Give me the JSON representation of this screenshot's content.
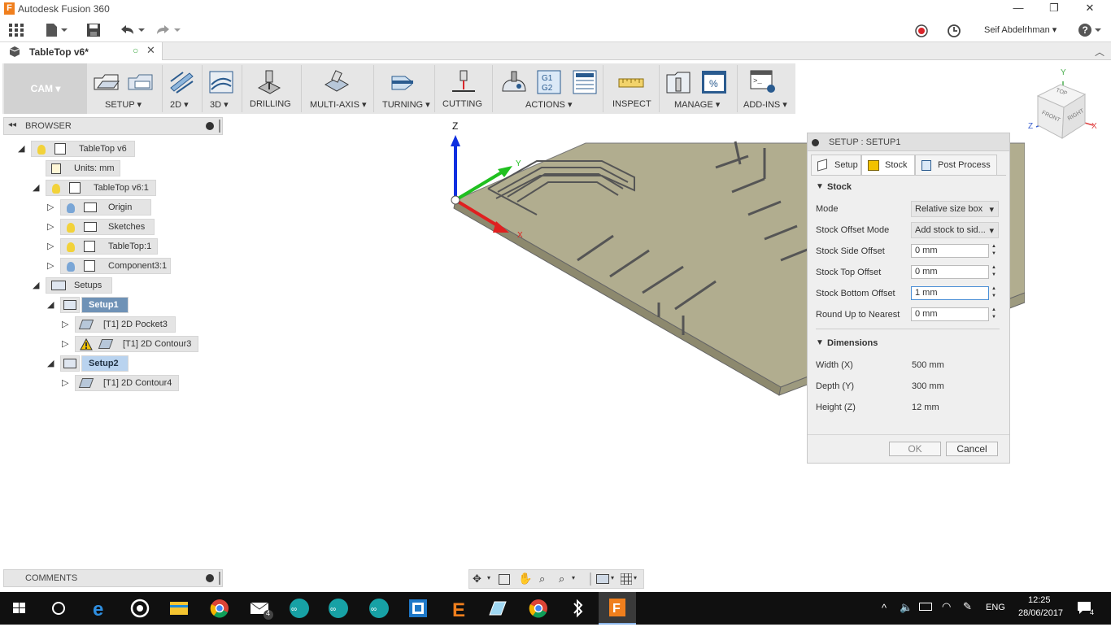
{
  "window": {
    "app_title": "Autodesk Fusion 360",
    "logo_letter": "F",
    "minimize": "—",
    "restore": "❐",
    "close": "✕"
  },
  "qat": {
    "user_name": "Seif Abdelrhman"
  },
  "document_tab": {
    "name": "TableTop v6*"
  },
  "ribbon": {
    "workspace": "CAM",
    "groups": [
      "SETUP",
      "2D",
      "3D",
      "DRILLING",
      "MULTI-AXIS",
      "TURNING",
      "CUTTING",
      "ACTIONS",
      "INSPECT",
      "MANAGE",
      "ADD-INS"
    ]
  },
  "browser": {
    "title": "BROWSER",
    "nodes": {
      "root": "TableTop v6",
      "units": "Units: mm",
      "component": "TableTop v6:1",
      "origin": "Origin",
      "sketches": "Sketches",
      "body": "TableTop:1",
      "component3": "Component3:1",
      "setups": "Setups",
      "setup1": "Setup1",
      "pocket3": "[T1] 2D Pocket3",
      "contour3": "[T1] 2D Contour3",
      "setup2": "Setup2",
      "contour4": "[T1] 2D Contour4"
    }
  },
  "comments": {
    "title": "COMMENTS"
  },
  "viewport": {
    "axis_z": "Z",
    "axis_y": "Y",
    "axis_x": "X",
    "cube_labels": {
      "top": "TOP",
      "front": "FRONT",
      "right": "RIGHT",
      "x": "X",
      "y": "Y",
      "z": "Z"
    }
  },
  "dialog": {
    "title": "SETUP : SETUP1",
    "tabs": [
      "Setup",
      "Stock",
      "Post Process"
    ],
    "stock_section": "Stock",
    "fields": {
      "mode_label": "Mode",
      "mode_value": "Relative size box",
      "offset_mode_label": "Stock Offset Mode",
      "offset_mode_value": "Add stock to sid...",
      "side_label": "Stock Side Offset",
      "side_value": "0 mm",
      "top_label": "Stock Top Offset",
      "top_value": "0 mm",
      "bottom_label": "Stock Bottom Offset",
      "bottom_value": "1 mm",
      "round_label": "Round Up to Nearest",
      "round_value": "0 mm"
    },
    "dimensions_section": "Dimensions",
    "dimensions": {
      "width_label": "Width (X)",
      "width_value": "500 mm",
      "depth_label": "Depth (Y)",
      "depth_value": "300 mm",
      "height_label": "Height (Z)",
      "height_value": "12 mm"
    },
    "ok": "OK",
    "cancel": "Cancel"
  },
  "taskbar": {
    "clock_time": "12:25",
    "clock_date": "28/06/2017",
    "language": "ENG",
    "notification_count": "4",
    "mail_count": "4"
  }
}
